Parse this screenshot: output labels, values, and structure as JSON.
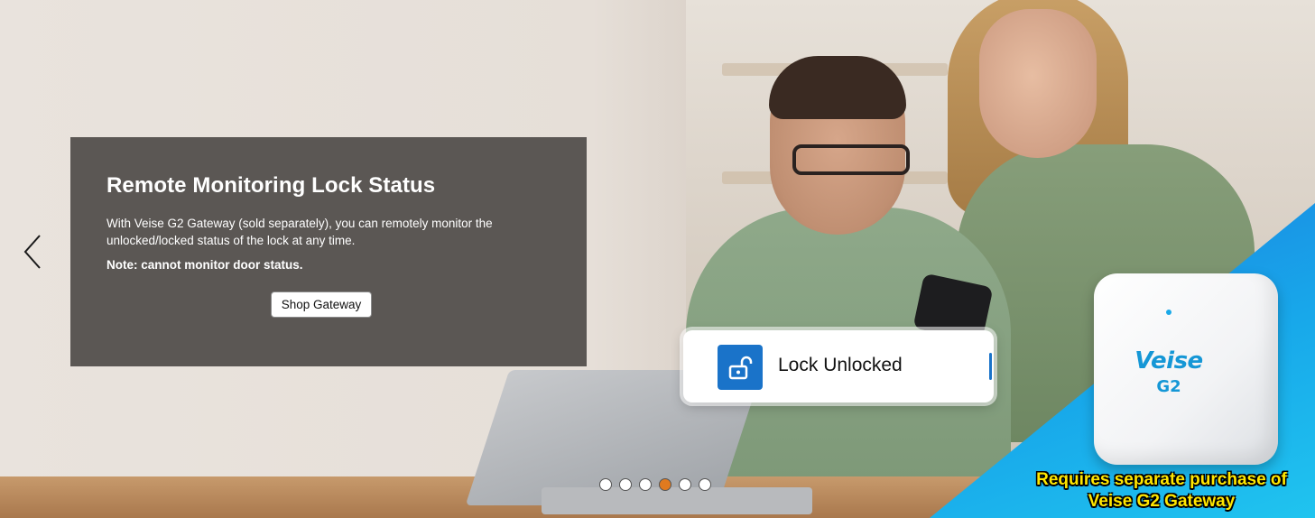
{
  "info_panel": {
    "title": "Remote Monitoring Lock Status",
    "body": "With Veise G2 Gateway (sold separately), you can remotely monitor the unlocked/locked status of the lock at any time.",
    "note": "Note: cannot monitor door status.",
    "button_label": "Shop Gateway"
  },
  "lock_card": {
    "status_text": "Lock Unlocked",
    "icon": "unlocked-padlock-icon",
    "accent_color": "#1a73c9"
  },
  "gateway": {
    "brand": "Veise",
    "model": "G2",
    "requirement_line1": "Requires separate purchase of",
    "requirement_line2": "Veise G2 Gateway",
    "highlight_color": "#ffe600",
    "background_color": "#18a8ea"
  },
  "carousel": {
    "prev_icon": "chevron-left-icon",
    "next_icon": "chevron-right-icon",
    "slide_count": 6,
    "active_index": 3,
    "active_dot_color": "#e07a1f"
  }
}
